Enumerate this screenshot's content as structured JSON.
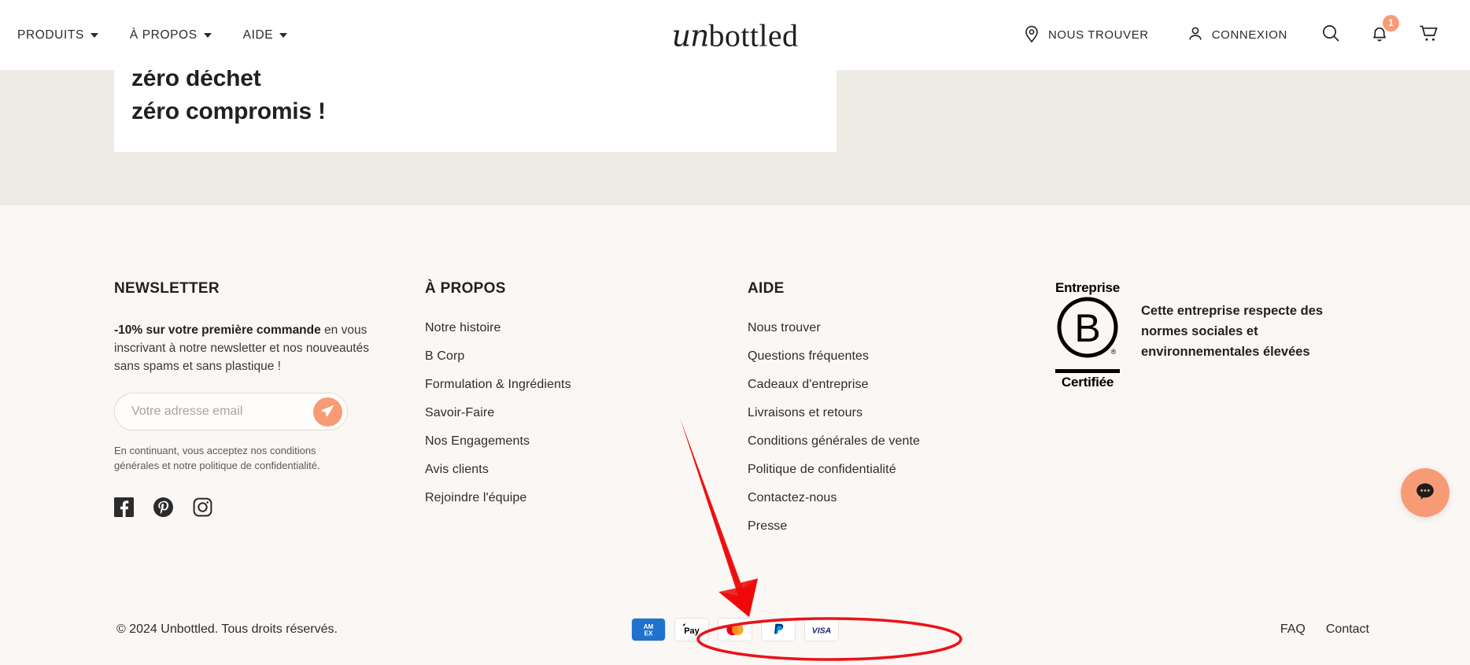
{
  "header": {
    "nav_left": [
      {
        "label": "PRODUITS",
        "has_caret": true
      },
      {
        "label": "À PROPOS",
        "has_caret": true
      },
      {
        "label": "AIDE",
        "has_caret": true
      }
    ],
    "logo": {
      "part1": "un",
      "part2": "bottled"
    },
    "find_us_label": "NOUS TROUVER",
    "account_label": "CONNEXION",
    "icons": [
      "location-pin-icon",
      "user-icon",
      "search-icon",
      "bell-icon",
      "cart-icon"
    ],
    "notification_count": "1",
    "badge_color": "#f79b77"
  },
  "banner": {
    "line1": "zéro déchet",
    "line2": "zéro compromis !",
    "band_color": "#eeeae4"
  },
  "footer": {
    "newsletter": {
      "title": "NEWSLETTER",
      "promo_bold": "-10% sur votre première commande",
      "promo_rest": " en vous inscrivant à notre newsletter et nos nouveautés sans spams et sans plastique !",
      "input_placeholder": "Votre adresse email",
      "input_value": "",
      "submit_icon": "paper-plane-icon",
      "legal": "En continuant, vous acceptez nos conditions générales et notre politique de confidentialité.",
      "socials": [
        "facebook-icon",
        "pinterest-icon",
        "instagram-icon"
      ]
    },
    "about": {
      "title": "À PROPOS",
      "links": [
        "Notre histoire",
        "B Corp",
        "Formulation & Ingrédients",
        "Savoir-Faire",
        "Nos Engagements",
        "Avis clients",
        "Rejoindre l'équipe"
      ]
    },
    "aide": {
      "title": "AIDE",
      "links": [
        "Nous trouver",
        "Questions fréquentes",
        "Cadeaux d'entreprise",
        "Livraisons et retours",
        "Conditions générales de vente",
        "Politique de confidentialité",
        "Contactez-nous",
        "Presse"
      ]
    },
    "bcorp": {
      "top_word": "Entreprise",
      "letter": "B",
      "bottom_word": "Certifiée",
      "description": "Cette entreprise respecte des normes sociales et environnementales élevées"
    },
    "bottom": {
      "copyright": "© 2024 Unbottled. Tous droits réservés.",
      "payments": [
        "amex",
        "apple-pay",
        "mastercard",
        "paypal",
        "visa"
      ],
      "links": [
        "FAQ",
        "Contact"
      ]
    }
  },
  "widgets": {
    "chat_fab_icon": "chat-bubble-icon",
    "chat_fab_color": "#f79b77"
  },
  "annotations": {
    "highlight_color": "#e8141a",
    "arrow": "red-arrow-pointing-to-payment-icons",
    "ellipse": "red-ellipse-around-payment-icons"
  }
}
